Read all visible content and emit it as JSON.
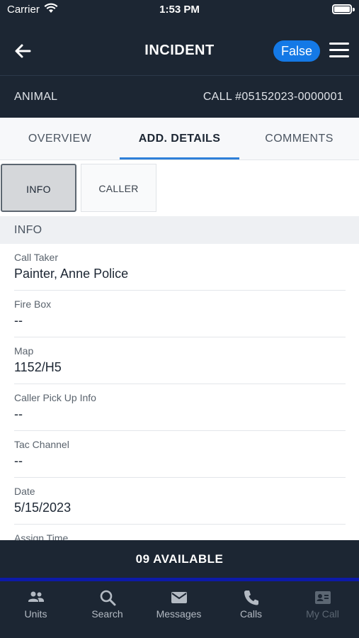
{
  "status_bar": {
    "carrier": "Carrier",
    "time": "1:53 PM"
  },
  "nav": {
    "title": "INCIDENT",
    "pill": "False"
  },
  "incident": {
    "type": "ANIMAL",
    "call_number": "CALL #05152023-0000001"
  },
  "tabs": [
    {
      "label": "OVERVIEW",
      "active": false
    },
    {
      "label": "ADD. DETAILS",
      "active": true
    },
    {
      "label": "COMMENTS",
      "active": false
    }
  ],
  "segments": [
    {
      "label": "INFO",
      "active": true
    },
    {
      "label": "CALLER",
      "active": false
    }
  ],
  "section_title": "INFO",
  "fields": [
    {
      "label": "Call Taker",
      "value": "Painter, Anne Police"
    },
    {
      "label": "Fire Box",
      "value": "--"
    },
    {
      "label": "Map",
      "value": "1152/H5"
    },
    {
      "label": "Caller Pick Up Info",
      "value": "--"
    },
    {
      "label": "Tac Channel",
      "value": "--"
    },
    {
      "label": "Date",
      "value": "5/15/2023"
    },
    {
      "label": "Assign Time",
      "value": ""
    }
  ],
  "availability": "09  AVAILABLE",
  "tab_bar": [
    {
      "label": "Units",
      "icon": "people-icon"
    },
    {
      "label": "Search",
      "icon": "search-icon"
    },
    {
      "label": "Messages",
      "icon": "envelope-icon"
    },
    {
      "label": "Calls",
      "icon": "phone-icon"
    },
    {
      "label": "My Call",
      "icon": "contact-card-icon",
      "disabled": true
    }
  ],
  "colors": {
    "dark": "#1c2633",
    "accent": "#1479e6",
    "tab_underline": "#2e7fd8",
    "avail_line": "#0d1aa8"
  }
}
